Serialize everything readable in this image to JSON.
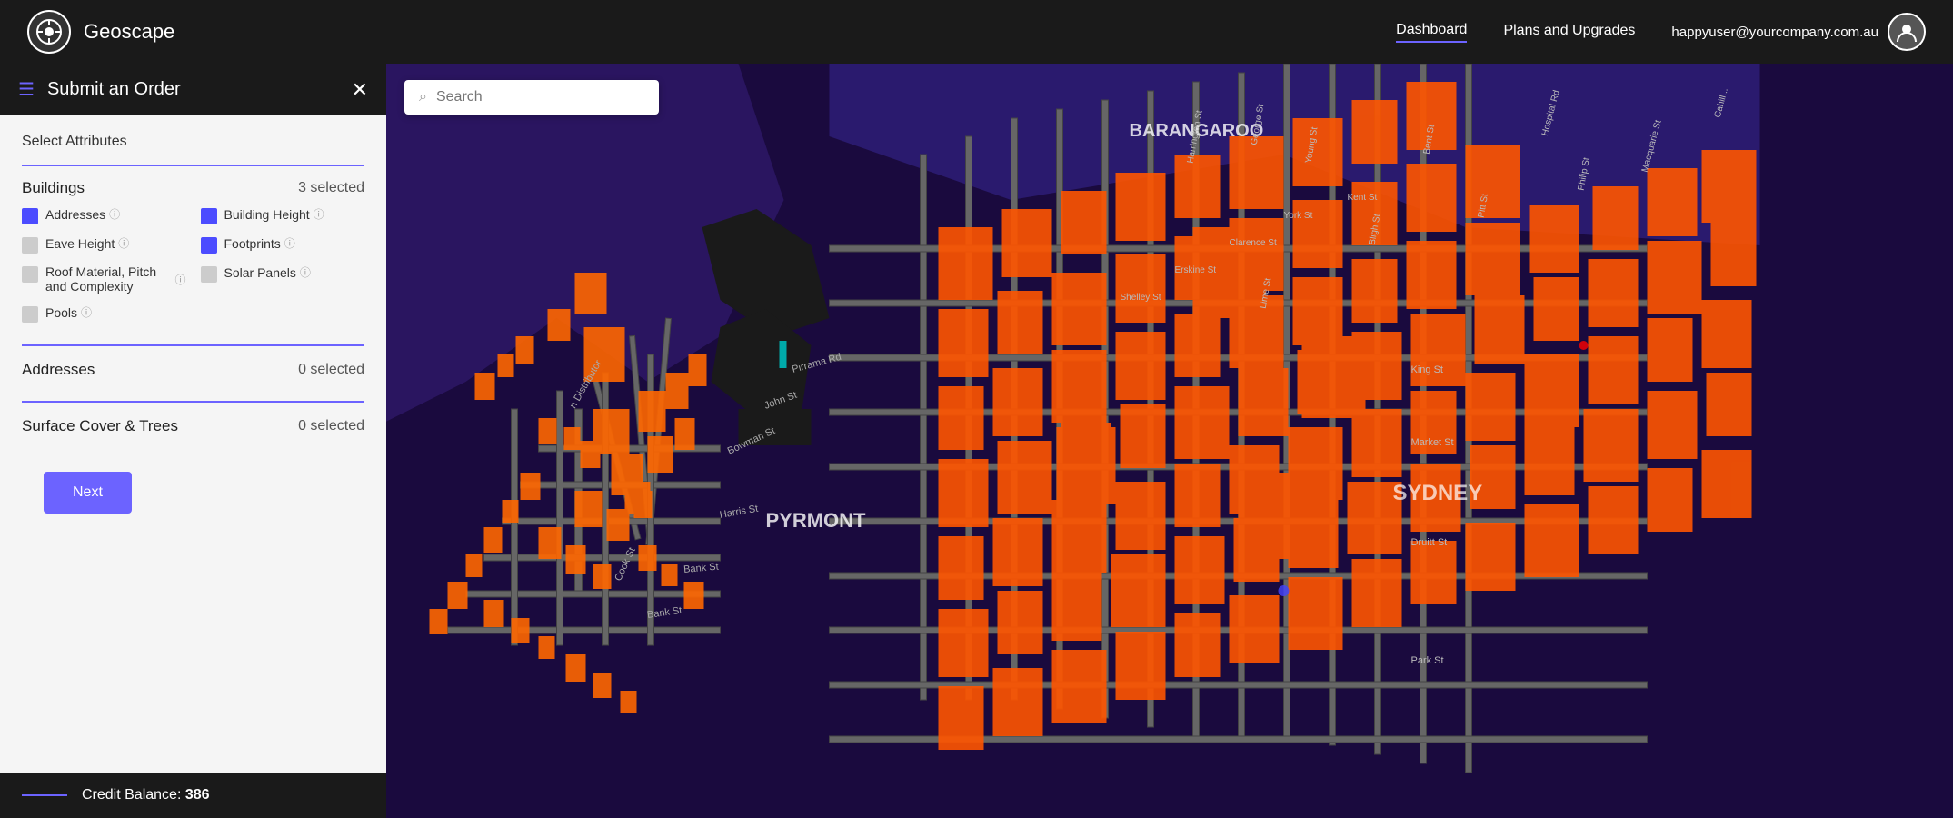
{
  "navbar": {
    "title": "Geoscape",
    "links": [
      {
        "label": "Dashboard",
        "active": true
      },
      {
        "label": "Plans and Upgrades",
        "active": false
      }
    ],
    "user_email": "happyuser@yourcompany.com.au"
  },
  "search": {
    "placeholder": "Search"
  },
  "sidebar": {
    "title": "Submit an Order",
    "select_label": "Select Attributes",
    "buildings": {
      "title": "Buildings",
      "count": "3 selected",
      "attributes": [
        {
          "label": "Addresses",
          "checked": true,
          "help": "?"
        },
        {
          "label": "Building Height",
          "checked": true,
          "help": "?"
        },
        {
          "label": "Eave Height",
          "checked": false,
          "help": "?"
        },
        {
          "label": "Footprints",
          "checked": true,
          "help": "?"
        },
        {
          "label": "Roof Material, Pitch and Complexity",
          "checked": false,
          "help": "?"
        },
        {
          "label": "Solar Panels",
          "checked": false,
          "help": "?"
        },
        {
          "label": "Pools",
          "checked": false,
          "help": "?"
        }
      ]
    },
    "addresses": {
      "title": "Addresses",
      "count": "0 selected"
    },
    "surface_trees": {
      "title": "Surface Cover & Trees",
      "count": "0 selected"
    },
    "next_label": "Next",
    "credit_label": "Credit Balance:",
    "credit_value": "386"
  }
}
